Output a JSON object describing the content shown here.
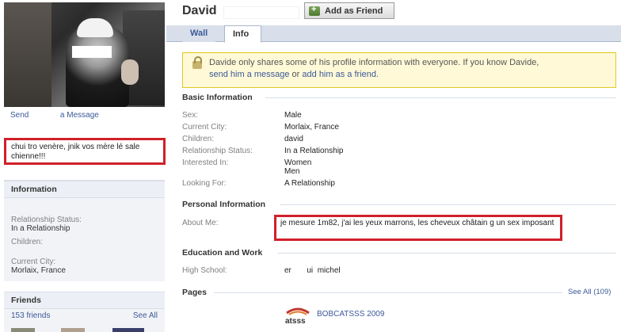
{
  "profile": {
    "name": "David",
    "add_friend_label": "Add as Friend"
  },
  "left": {
    "send_message_parts": [
      "Send",
      "a Message"
    ],
    "status_text": "chui tro venère, jnik vos mère lé sale chienne!!!",
    "information": {
      "heading": "Information",
      "items": [
        {
          "label": "Relationship Status:",
          "value": "In a Relationship"
        },
        {
          "label": "Children:",
          "value": ""
        },
        {
          "label": "Current City:",
          "value": "Morlaix, France"
        }
      ]
    },
    "friends": {
      "heading": "Friends",
      "count": "153 friends",
      "see_all": "See All"
    }
  },
  "tabs": [
    {
      "label": "Wall",
      "active": false
    },
    {
      "label": "Info",
      "active": true
    }
  ],
  "notice": {
    "text_before": "Davide only shares some of his profile information with everyone. If you know Davide,",
    "link_message": "send him a message",
    "text_or": " or ",
    "link_friend": "add him as a friend",
    "text_end": "."
  },
  "basic_information": {
    "heading": "Basic Information",
    "rows": [
      {
        "label": "Sex:",
        "value": "Male"
      },
      {
        "label": "Current City:",
        "value": "Morlaix, France"
      },
      {
        "label": "Children:",
        "value": "david"
      },
      {
        "label": "Relationship Status:",
        "value": "In a Relationship"
      },
      {
        "label": "Interested In:",
        "value": "Women",
        "value2": "Men"
      },
      {
        "label": "Looking For:",
        "value": "A Relationship"
      }
    ]
  },
  "personal_information": {
    "heading": "Personal Information",
    "about_label": "About Me:",
    "about_text": "je mesure 1m82, j'ai les yeux marrons, les cheveux châtain g un sex imposant"
  },
  "education": {
    "heading": "Education and Work",
    "high_school_label": "High School:",
    "high_school_parts": [
      "er",
      "ui",
      "michel"
    ]
  },
  "pages": {
    "heading": "Pages",
    "see_all": "See All (109)",
    "item": "BOBCATSSS 2009",
    "logo_text": "atsss"
  },
  "colors": {
    "link": "#3b5998",
    "highlight_border": "#d0202a",
    "notice_bg": "#fff9d7"
  }
}
